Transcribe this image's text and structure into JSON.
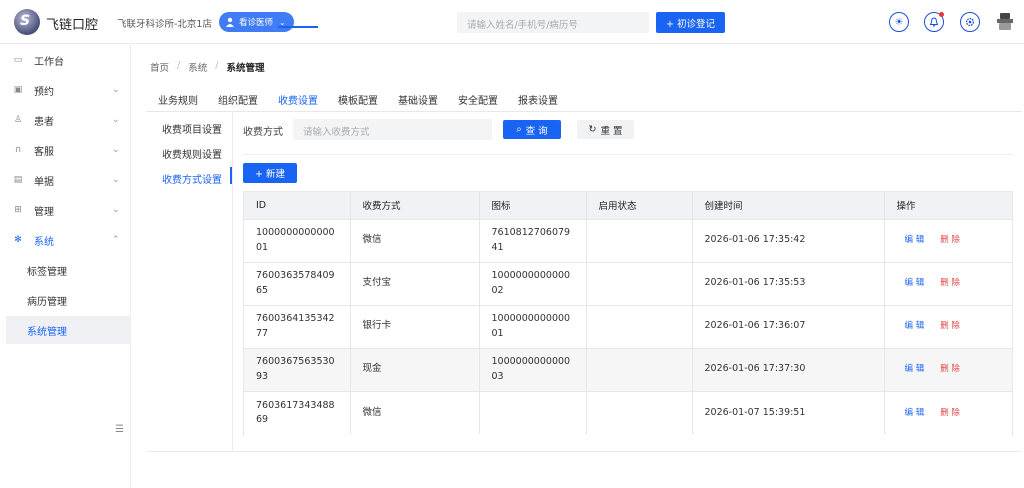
{
  "header": {
    "app_name": "飞链口腔",
    "clinic": "飞联牙科诊所-北京1店",
    "role": "看诊医师",
    "search_placeholder": "请输入姓名/手机号/病历号",
    "new_visit": "+ 初诊登记",
    "icons": [
      "sun-icon",
      "bell-icon",
      "settings-icon",
      "user-avatar-icon"
    ]
  },
  "sidebar": {
    "items": [
      {
        "label": "工作台",
        "icon": "monitor-icon",
        "chevron": false
      },
      {
        "label": "预约",
        "icon": "calendar-icon",
        "chevron": true
      },
      {
        "label": "患者",
        "icon": "user-icon",
        "chevron": true
      },
      {
        "label": "客服",
        "icon": "headset-icon",
        "chevron": true
      },
      {
        "label": "单据",
        "icon": "document-icon",
        "chevron": true
      },
      {
        "label": "管理",
        "icon": "grid-icon",
        "chevron": true
      },
      {
        "label": "系统",
        "icon": "gear-icon",
        "chevron": true,
        "active": true
      }
    ],
    "sub_items": [
      {
        "label": "标签管理"
      },
      {
        "label": "病历管理"
      },
      {
        "label": "系统管理",
        "active": true
      }
    ]
  },
  "breadcrumb": [
    "首页",
    "系统",
    "系统管理"
  ],
  "tabs": [
    "业务规则",
    "组织配置",
    "收费设置",
    "模板配置",
    "基础设置",
    "安全配置",
    "报表设置"
  ],
  "active_tab": "收费设置",
  "subnav": [
    "收费项目设置",
    "收费规则设置",
    "收费方式设置"
  ],
  "active_subnav": "收费方式设置",
  "filter": {
    "label": "收费方式",
    "placeholder": "请输入收费方式",
    "query": "查 询",
    "reset": "重 置"
  },
  "new_button": "+ 新建",
  "table": {
    "columns": [
      "ID",
      "收费方式",
      "图标",
      "启用状态",
      "创建时间",
      "操作"
    ],
    "rows": [
      {
        "id": "100000000000001",
        "method": "微信",
        "icon": "761081270607941",
        "status": "",
        "created": "2026-01-06 17:35:42"
      },
      {
        "id": "760036357840965",
        "method": "支付宝",
        "icon": "100000000000002",
        "status": "",
        "created": "2026-01-06 17:35:53"
      },
      {
        "id": "760036413534277",
        "method": "银行卡",
        "icon": "100000000000001",
        "status": "",
        "created": "2026-01-06 17:36:07"
      },
      {
        "id": "760036756353093",
        "method": "现金",
        "icon": "100000000000003",
        "status": "",
        "created": "2026-01-06 17:37:30"
      },
      {
        "id": "760361734348869",
        "method": "微信",
        "icon": "",
        "status": "",
        "created": "2026-01-07 15:39:51"
      }
    ],
    "edit_label": "编 辑",
    "delete_label": "删 除"
  }
}
